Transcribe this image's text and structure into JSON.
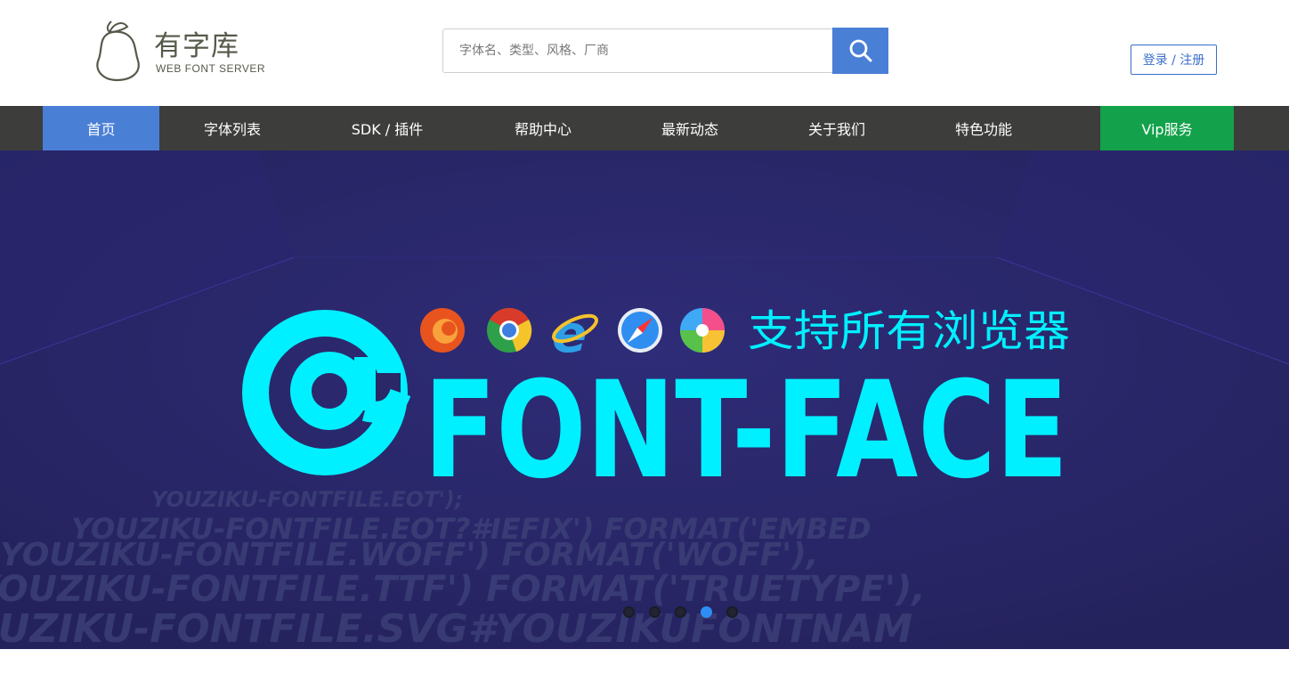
{
  "logo": {
    "title": "有字库",
    "subtitle": "WEB FONT SERVER",
    "icon": "pear-icon"
  },
  "search": {
    "placeholder": "字体名、类型、风格、厂商",
    "value": "",
    "button_icon": "search-icon"
  },
  "auth": {
    "login_label": "登录 / 注册"
  },
  "nav": {
    "items": [
      {
        "label": "首页",
        "active": true
      },
      {
        "label": "字体列表"
      },
      {
        "label": "SDK / 插件"
      },
      {
        "label": "帮助中心"
      },
      {
        "label": "最新动态"
      },
      {
        "label": "关于我们"
      },
      {
        "label": "特色功能"
      },
      {
        "label": "Vip服务"
      }
    ]
  },
  "banner": {
    "tagline": "支持所有浏览器",
    "headline": "@FONT-FACE",
    "code_lines": [
      "YOUZIKU-FONTFILE.EOT');",
      "YOUZIKU-FONTFILE.EOT?#IEFIX') FORMAT('EMBED",
      "YOUZIKU-FONTFILE.WOFF') FORMAT('WOFF'),",
      "YOUZIKU-FONTFILE.TTF') FORMAT('TRUETYPE'),",
      "YOUZIKU-FONTFILE.SVG#YOUZIKUFONTNAM"
    ],
    "browser_icons": [
      "firefox-icon",
      "chrome-icon",
      "ie-icon",
      "safari-icon",
      "browser-360-icon"
    ],
    "slides": 5,
    "active_slide": 4
  },
  "colors": {
    "nav_bg": "#3d3d3b",
    "nav_active": "#4a7fd6",
    "vip": "#13a24b",
    "banner_bg": "#2b2868",
    "headline": "#00f0ff",
    "link_blue": "#3b6fc9"
  }
}
